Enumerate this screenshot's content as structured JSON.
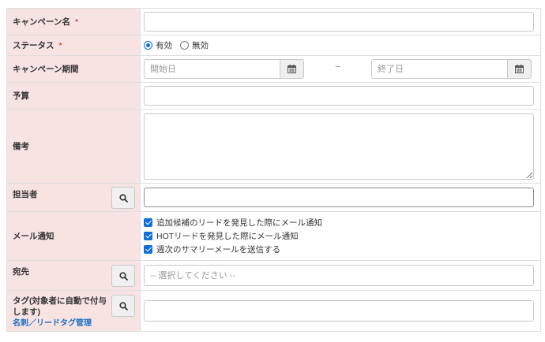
{
  "form": {
    "campaign_name": {
      "label": "キャンペーン名",
      "required_mark": "*",
      "value": ""
    },
    "status": {
      "label": "ステータス",
      "required_mark": "*",
      "options": [
        {
          "label": "有効",
          "selected": true
        },
        {
          "label": "無効",
          "selected": false
        }
      ]
    },
    "period": {
      "label": "キャンペーン期間",
      "start_placeholder": "開始日",
      "separator": "~",
      "end_placeholder": "終了日",
      "icon": "calendar-icon"
    },
    "budget": {
      "label": "予算",
      "value": ""
    },
    "notes": {
      "label": "備考",
      "value": ""
    },
    "owner": {
      "label": "担当者",
      "value": "",
      "icon": "search-icon"
    },
    "mail_notice": {
      "label": "メール通知",
      "options": [
        {
          "label": "追加候補のリードを発見した際にメール通知",
          "checked": true
        },
        {
          "label": "HOTリードを発見した際にメール通知",
          "checked": true
        },
        {
          "label": "週次のサマリーメールを送信する",
          "checked": true
        }
      ]
    },
    "recipient": {
      "label": "宛先",
      "placeholder": "-- 選択してください --",
      "icon": "search-icon"
    },
    "tags": {
      "label_line1": "タグ(対象者に自動で付与",
      "label_line2": "します)",
      "manage_link": "名刺／リードタグ管理",
      "value": "",
      "icon": "search-icon"
    }
  },
  "colors": {
    "label_bg": "#f8e3e3",
    "border": "#dddddd",
    "required": "#d9534f",
    "accent": "#0f6fde",
    "link": "#1a6fc4"
  }
}
